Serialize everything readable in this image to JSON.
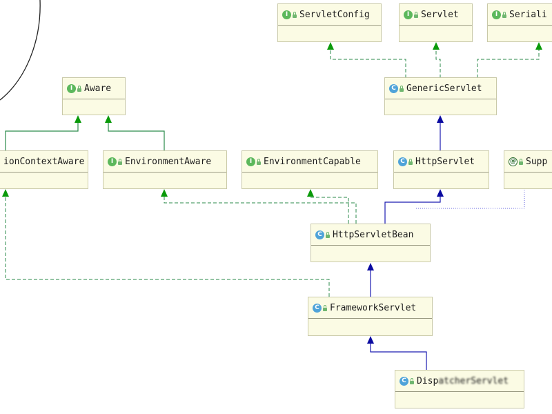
{
  "diagram": {
    "nodes": {
      "servlet_config": {
        "badge": "I",
        "name": "ServletConfig"
      },
      "servlet": {
        "badge": "I",
        "name": "Servlet"
      },
      "serializable": {
        "badge": "I",
        "name": "Seriali"
      },
      "generic_servlet": {
        "badge": "C",
        "name": "GenericServlet"
      },
      "aware": {
        "badge": "I",
        "name": "Aware"
      },
      "application_context_aware": {
        "badge": "I",
        "name": "ionContextAware"
      },
      "environment_aware": {
        "badge": "I",
        "name": "EnvironmentAware"
      },
      "environment_capable": {
        "badge": "I",
        "name": "EnvironmentCapable"
      },
      "http_servlet": {
        "badge": "C",
        "name": "HttpServlet"
      },
      "supp": {
        "badge": "@",
        "name": "Supp"
      },
      "http_servlet_bean": {
        "badge": "C",
        "name": "HttpServletBean"
      },
      "framework_servlet": {
        "badge": "C",
        "name": "FrameworkServlet"
      },
      "dispatcher_servlet": {
        "badge": "C",
        "name": "Disp",
        "name_obscured": "atcherServlet"
      }
    },
    "colors": {
      "implements": "#2a8a4a",
      "extends": "#1a1ab0",
      "implements_arrow": "#0a9a0a",
      "extends_arrow": "#0a0aa0",
      "node_fill": "#fbfbe4"
    }
  }
}
